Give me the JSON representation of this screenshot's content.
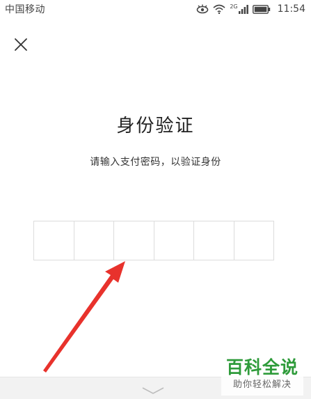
{
  "status_bar": {
    "carrier": "中国移动",
    "network": "2G",
    "time": "11:54"
  },
  "header": {
    "close_icon": "close-icon"
  },
  "main": {
    "title": "身份验证",
    "subtitle": "请输入支付密码，以验证身份",
    "pin_length": 6
  },
  "bottom": {
    "collapse_icon": "chevron-down-icon"
  },
  "watermark": {
    "main": "百科全说",
    "sub": "助你轻松解决"
  },
  "colors": {
    "annotation_arrow": "#e8322c",
    "watermark_green": "#2e9b3a",
    "pin_border": "#dcdcdc"
  }
}
